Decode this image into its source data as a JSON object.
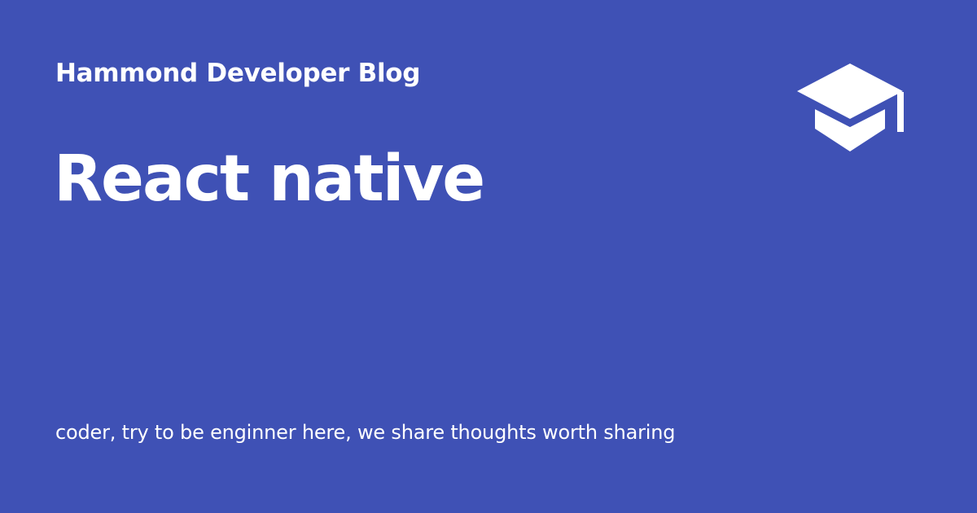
{
  "site": {
    "name": "Hammond Developer Blog",
    "logo_icon": "graduation-cap-icon"
  },
  "post": {
    "title": "React native"
  },
  "footer": {
    "tagline": "coder, try to be enginner here, we share thoughts worth sharing"
  },
  "colors": {
    "background": "#3f51b5",
    "text": "#ffffff"
  }
}
